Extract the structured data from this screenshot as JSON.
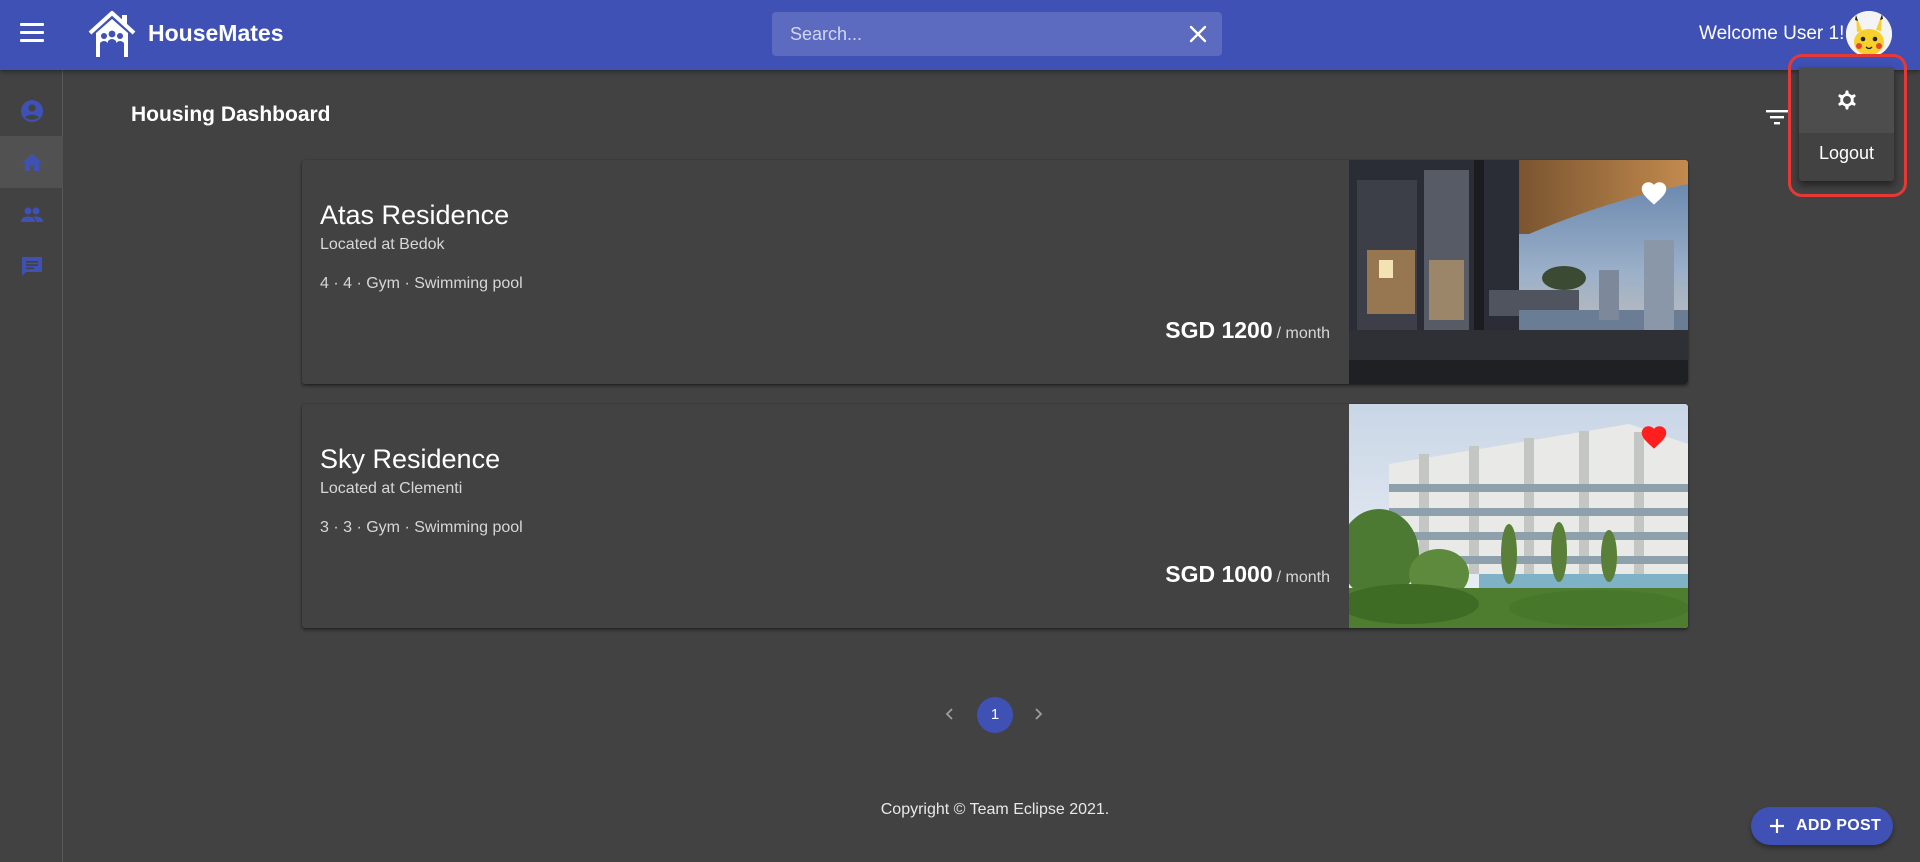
{
  "appbar": {
    "brand": "HouseMates",
    "search_placeholder": "Search...",
    "welcome": "Welcome User 1!"
  },
  "sidebar": {
    "items": [
      {
        "icon": "account-circle-icon",
        "active": false
      },
      {
        "icon": "home-icon",
        "active": true
      },
      {
        "icon": "people-icon",
        "active": false
      },
      {
        "icon": "chat-icon",
        "active": false
      }
    ]
  },
  "page": {
    "title": "Housing Dashboard"
  },
  "listings": [
    {
      "name": "Atas Residence",
      "location": "Located at Bedok",
      "features": "4 · 4 · Gym · Swimming pool",
      "price": "SGD 1200",
      "price_unit": "/ month",
      "favorited": false
    },
    {
      "name": "Sky Residence",
      "location": "Located at Clementi",
      "features": "3 · 3 · Gym · Swimming pool",
      "price": "SGD 1000",
      "price_unit": "/ month",
      "favorited": true
    }
  ],
  "pagination": {
    "current_page": "1"
  },
  "footer": {
    "copyright": "Copyright © Team Eclipse 2021."
  },
  "fab": {
    "label": "ADD POST"
  },
  "user_menu": {
    "logout_label": "Logout"
  },
  "colors": {
    "primary": "#3f51b5",
    "background": "#424242",
    "favorite_active": "#ff1f1f",
    "highlight_outline": "#e53935"
  }
}
